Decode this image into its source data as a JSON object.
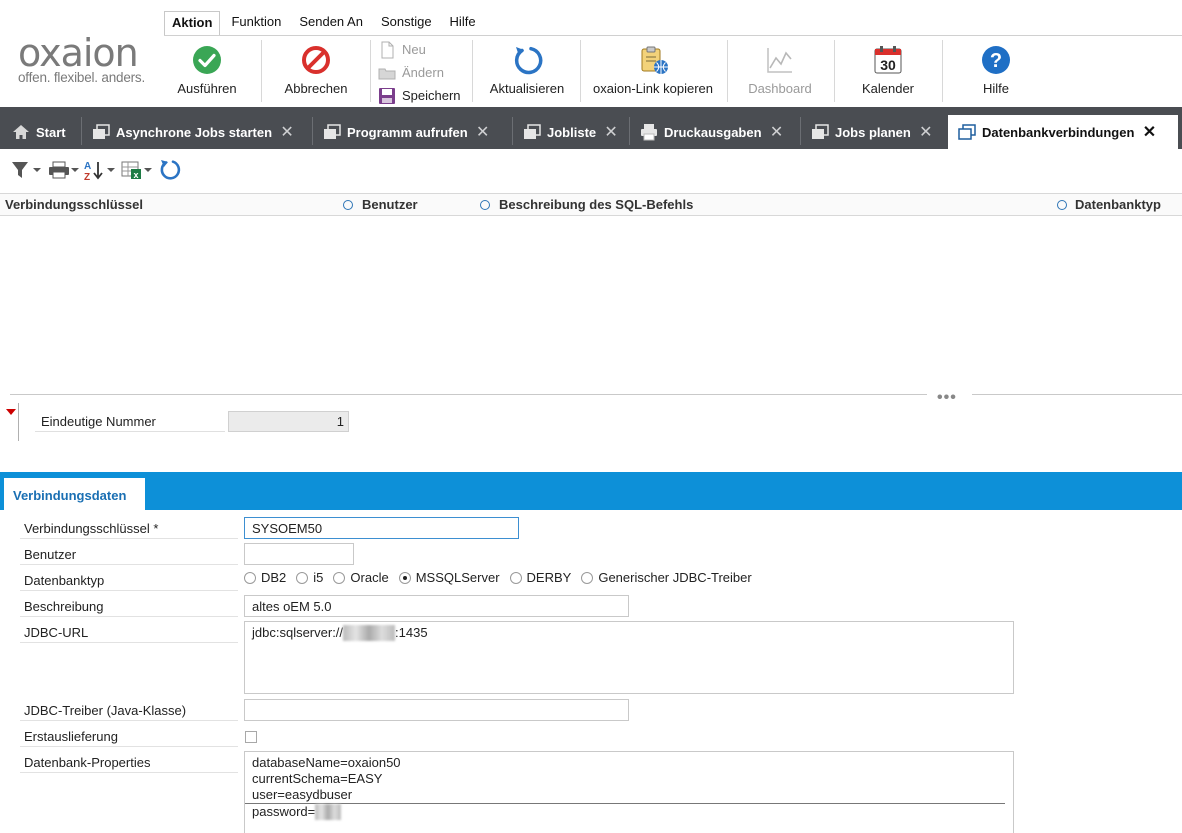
{
  "logo": {
    "word": "oxaion",
    "tagline": "offen. flexibel. anders."
  },
  "menu": [
    "Aktion",
    "Funktion",
    "Senden An",
    "Sonstige",
    "Hilfe"
  ],
  "ribbon": {
    "execute": "Ausführen",
    "cancel": "Abbrechen",
    "new": "Neu",
    "edit": "Ändern",
    "save": "Speichern",
    "refresh": "Aktualisieren",
    "copy_link": "oxaion-Link kopieren",
    "dashboard": "Dashboard",
    "calendar": "Kalender",
    "calendar_day": "30",
    "help": "Hilfe"
  },
  "tabs": [
    {
      "label": "Start"
    },
    {
      "label": "Asynchrone Jobs starten"
    },
    {
      "label": "Programm aufrufen"
    },
    {
      "label": "Jobliste"
    },
    {
      "label": "Druckausgaben"
    },
    {
      "label": "Jobs planen"
    },
    {
      "label": "Datenbankverbindungen"
    }
  ],
  "grid": {
    "columns": [
      "Verbindungsschlüssel",
      "Benutzer",
      "Beschreibung des SQL-Befehls",
      "Datenbanktyp"
    ]
  },
  "detail": {
    "unique_label": "Eindeutige Nummer",
    "unique_value": "1"
  },
  "section_tab": "Verbindungsdaten",
  "form": {
    "key_label": "Verbindungsschlüssel *",
    "key_value": "SYSOEM50",
    "user_label": "Benutzer",
    "user_value": "",
    "dbtype_label": "Datenbanktyp",
    "dbtypes": [
      "DB2",
      "i5",
      "Oracle",
      "MSSQLServer",
      "DERBY",
      "Generischer JDBC-Treiber"
    ],
    "dbtype_selected": "MSSQLServer",
    "desc_label": "Beschreibung",
    "desc_value": "altes oEM 5.0",
    "jdbc_label": "JDBC-URL",
    "jdbc_prefix": "jdbc:sqlserver://",
    "jdbc_suffix": ":1435",
    "driver_label": "JDBC-Treiber (Java-Klasse)",
    "driver_value": "",
    "first_delivery_label": "Erstauslieferung",
    "props_label": "Datenbank-Properties",
    "props_lines": [
      "databaseName=oxaion50",
      "currentSchema=EASY",
      "user=easydbuser",
      "password="
    ]
  },
  "colors": {
    "accent": "#0d90d8",
    "tabbar": "#4a4d52",
    "execute_green": "#3aa655",
    "cancel_red": "#d9302c",
    "help_blue": "#1f6fc5"
  }
}
